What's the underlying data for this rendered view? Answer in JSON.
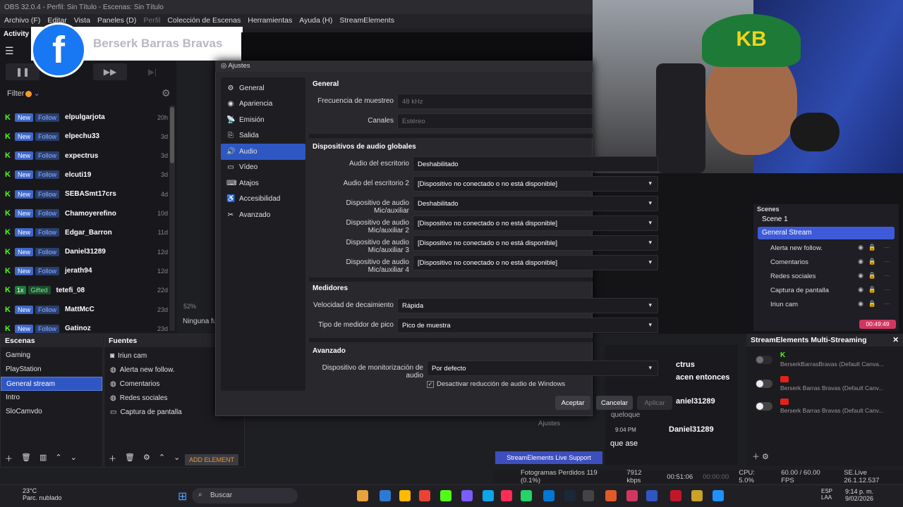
{
  "window": {
    "title": "OBS 32.0.4 - Perfil: Sin Título - Escenas: Sin Título"
  },
  "menu": [
    "Archivo (F)",
    "Editar",
    "Vista",
    "Paneles (D)",
    "Perfil",
    "Colección de Escenas",
    "Herramientas",
    "Ayuda (H)",
    "StreamElements"
  ],
  "activity": {
    "title": "Activity fe",
    "filter": "Filter",
    "rows": [
      {
        "a": "New",
        "b": "Follow",
        "name": "elpulgarjota",
        "time": "20h"
      },
      {
        "a": "New",
        "b": "Follow",
        "name": "elpechu33",
        "time": "3d"
      },
      {
        "a": "New",
        "b": "Follow",
        "name": "expectrus",
        "time": "3d"
      },
      {
        "a": "New",
        "b": "Follow",
        "name": "elcuti19",
        "time": "3d"
      },
      {
        "a": "New",
        "b": "Follow",
        "name": "SEBASmt17crs",
        "time": "4d"
      },
      {
        "a": "New",
        "b": "Follow",
        "name": "Chamoyerefino",
        "time": "10d"
      },
      {
        "a": "New",
        "b": "Follow",
        "name": "Edgar_Barron",
        "time": "11d"
      },
      {
        "a": "New",
        "b": "Follow",
        "name": "Daniel31289",
        "time": "12d"
      },
      {
        "a": "New",
        "b": "Follow",
        "name": "jerath94",
        "time": "12d"
      },
      {
        "a": "1x",
        "b": "Gifted",
        "name": "tetefi_08",
        "time": "22d"
      },
      {
        "a": "New",
        "b": "Follow",
        "name": "MattMcC",
        "time": "23d"
      },
      {
        "a": "New",
        "b": "Follow",
        "name": "Gatinoz",
        "time": "23d"
      }
    ]
  },
  "facebook": {
    "name": "Berserk Barras Bravas",
    "logo": "f"
  },
  "preview": {
    "zoom": "52%",
    "none_text": "Ninguna fu"
  },
  "scenes": {
    "title": "Escenas",
    "items": [
      "Gaming",
      "PlayStation",
      "General stream",
      "Intro",
      "SloCamvdo"
    ]
  },
  "sources": {
    "title": "Fuentes",
    "items": [
      "Iriun cam",
      "Alerta new follow.",
      "Comentarios",
      "Redes sociales",
      "Captura de pantalla"
    ],
    "add_element": "ADD ELEMENT"
  },
  "dialog": {
    "title": "Ajustes",
    "nav": [
      {
        "label": "General",
        "icon": "⚙"
      },
      {
        "label": "Apariencia",
        "icon": "◉"
      },
      {
        "label": "Emisión",
        "icon": "📡"
      },
      {
        "label": "Salida",
        "icon": "⎘"
      },
      {
        "label": "Audio",
        "icon": "🔊"
      },
      {
        "label": "Vídeo",
        "icon": "▭"
      },
      {
        "label": "Atajos",
        "icon": "⌨"
      },
      {
        "label": "Accesibilidad",
        "icon": "♿"
      },
      {
        "label": "Avanzado",
        "icon": "✂"
      }
    ],
    "general": {
      "title": "General",
      "sample_rate_label": "Frecuencia de muestreo",
      "sample_rate": "48 kHz",
      "channels_label": "Canales",
      "channels": "Estéreo"
    },
    "global": {
      "title": "Dispositivos de audio globales",
      "rows": [
        {
          "label": "Audio del escritorio",
          "value": "Deshabilitado"
        },
        {
          "label": "Audio del escritorio 2",
          "value": "[Dispositivo no conectado o no está disponible]"
        },
        {
          "label": "Dispositivo de audio Mic/auxiliar",
          "value": "Deshabilitado"
        },
        {
          "label": "Dispositivo de audio Mic/auxiliar 2",
          "value": "[Dispositivo no conectado o no está disponible]"
        },
        {
          "label": "Dispositivo de audio Mic/auxiliar 3",
          "value": "[Dispositivo no conectado o no está disponible]"
        },
        {
          "label": "Dispositivo de audio Mic/auxiliar 4",
          "value": "[Dispositivo no conectado o no está disponible]"
        }
      ]
    },
    "meters": {
      "title": "Medidores",
      "decay_label": "Velocidad de decaimiento",
      "decay": "Rápida",
      "peak_label": "Tipo de medidor de pico",
      "peak": "Pico de muestra"
    },
    "advanced": {
      "title": "Avanzado",
      "monitor_label": "Dispositivo de monitorización de audio",
      "monitor": "Por defecto",
      "ducking": "Desactivar reducción de audio de Windows"
    },
    "buttons": {
      "ok": "Aceptar",
      "cancel": "Cancelar",
      "apply": "Aplicar"
    }
  },
  "obs_scenes": {
    "title": "Scenes",
    "current": "Scene 1",
    "items": [
      "General Stream",
      "Alerta new follow.",
      "Comentarios",
      "Redes sociales",
      "Captura de pantalla",
      "Iriun cam"
    ],
    "rec_time": "00:49:49"
  },
  "chat": {
    "lines": [
      "ctrus",
      "acen entonces",
      "aniel31289",
      "queloque",
      "Daniel31289",
      "que ase"
    ],
    "time": "9:04 PM"
  },
  "multistream": {
    "title": "StreamElements Multi-Streaming",
    "rows": [
      "BerserkBarrasBravas (Default Canva...",
      "Berserk Barras Bravas (Default Canv...",
      "Berserk Barras Bravas (Default Canv..."
    ]
  },
  "status": {
    "dropped": "Fotogramas Perdidos 119 (0.1%)",
    "kbps": "7912 kbps",
    "live": "00:51:06",
    "rec": "00:00:00",
    "cpu": "CPU: 5.0%",
    "fps": "60.00 / 60.00 FPS",
    "version": "SE.Live 26.1.12.537"
  },
  "se_support": "StreamElements Live Support",
  "ajustes_bg": "Ajustes",
  "taskbar": {
    "temp": "23°C",
    "weather": "Parc. nublado",
    "search": "Buscar",
    "lang1": "ESP",
    "lang2": "LAA",
    "time": "9:14 p. m.",
    "date": "9/02/2026"
  },
  "colors": {
    "accent": "#2f57c4",
    "kick": "#53fc18",
    "rec": "#d23660"
  }
}
